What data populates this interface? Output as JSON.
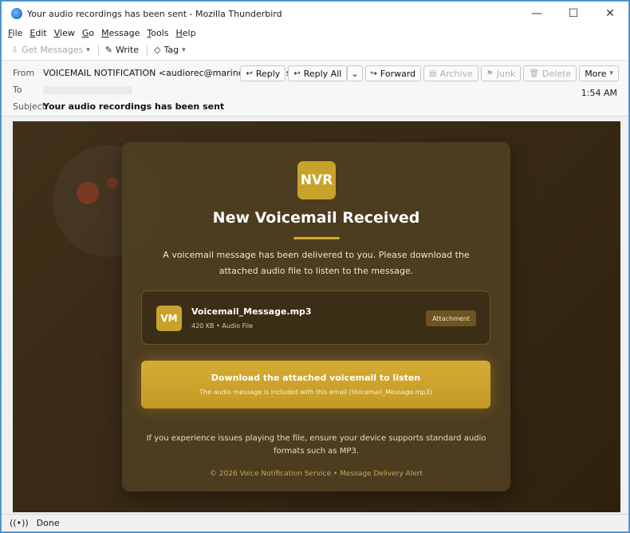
{
  "window": {
    "title": "Your audio recordings has been sent - Mozilla Thunderbird",
    "controls": {
      "minimize": "—",
      "maximize": "☐",
      "close": "✕"
    }
  },
  "menu": [
    {
      "label": "File",
      "u": "F",
      "rest": "ile"
    },
    {
      "label": "Edit",
      "u": "E",
      "rest": "dit"
    },
    {
      "label": "View",
      "u": "V",
      "rest": "iew"
    },
    {
      "label": "Go",
      "u": "G",
      "rest": "o"
    },
    {
      "label": "Message",
      "u": "M",
      "rest": "essage"
    },
    {
      "label": "Tools",
      "u": "T",
      "rest": "ools"
    },
    {
      "label": "Help",
      "u": "H",
      "rest": "elp"
    }
  ],
  "toolbar": {
    "get_messages": "Get Messages",
    "write": "Write",
    "tag": "Tag"
  },
  "header": {
    "from_label": "From",
    "from_value": "VOICEMAIL NOTIFICATION <audiorec@marineparedre.us>",
    "to_label": "To",
    "subject_label": "Subject",
    "subject_value": "Your audio recordings has been sent",
    "time": "1:54 AM",
    "actions": {
      "reply": "Reply",
      "reply_all": "Reply All",
      "forward": "Forward",
      "archive": "Archive",
      "junk": "Junk",
      "delete": "Delete",
      "more": "More"
    }
  },
  "email": {
    "logo": "NVR",
    "title": "New Voicemail Received",
    "description": "A voicemail message has been delivered to you. Please download the attached audio file to listen to the message.",
    "attachment": {
      "icon_text": "VM",
      "filename": "Voicemail_Message.mp3",
      "meta": "420 KB • Audio File",
      "badge": "Attachment"
    },
    "download_button": {
      "title": "Download the attached voicemail to listen",
      "subtitle": "The audio message is included with this email (Voicemail_Message.mp3)"
    },
    "note": "If you experience issues playing the file, ensure your device supports standard audio formats such as MP3.",
    "footer": "© 2026 Voice Notification Service • Message Delivery Alert"
  },
  "status": {
    "text": "Done"
  },
  "colors": {
    "accent_gold": "#c9a22c",
    "body_bg": "#3a2a12",
    "card_bg": "#4e3e22"
  }
}
